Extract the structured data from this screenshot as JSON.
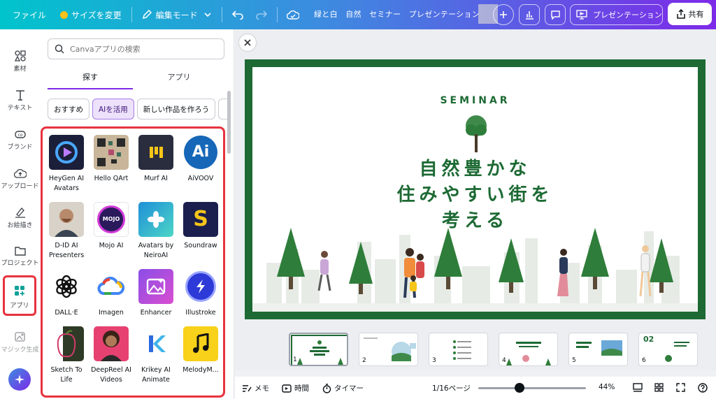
{
  "topbar": {
    "file_menu": "ファイル",
    "resize": "サイズを変更",
    "edit_mode": "編集モード",
    "document_title": "緑と白　自然　セミナー　プレゼンテーション",
    "present": "プレゼンテーション",
    "share": "共有",
    "gradient_colors": [
      "#00c4cc",
      "#3d8be0",
      "#7d2ae8"
    ]
  },
  "rail": {
    "items": [
      {
        "label": "素材",
        "icon": "elements-icon"
      },
      {
        "label": "テキスト",
        "icon": "text-icon"
      },
      {
        "label": "ブランド",
        "icon": "brand-icon"
      },
      {
        "label": "アップロード",
        "icon": "upload-icon"
      },
      {
        "label": "お絵描き",
        "icon": "draw-icon"
      },
      {
        "label": "プロジェクト",
        "icon": "folder-icon"
      },
      {
        "label": "アプリ",
        "icon": "apps-icon"
      },
      {
        "label": "マジック生成",
        "icon": "magic-media-icon"
      }
    ],
    "highlight_color": "#e7323f"
  },
  "panel": {
    "search_placeholder": "Canvaアプリの検索",
    "tabs": [
      "探す",
      "アプリ"
    ],
    "chips": [
      "おすすめ",
      "AIを活用",
      "新しい作品を作ろう"
    ],
    "apps": [
      {
        "name": "HeyGen AI Avatars",
        "color": "#1b1f3a"
      },
      {
        "name": "Hello QArt",
        "color": "#c9b59a"
      },
      {
        "name": "Murf AI",
        "color": "#2a2d3e"
      },
      {
        "name": "AiVOOV",
        "color": "#1667b8"
      },
      {
        "name": "D-ID AI Presenters",
        "color": "#8a7462"
      },
      {
        "name": "Mojo AI",
        "color": "#ffffff"
      },
      {
        "name": "Avatars by NeiroAI",
        "color": "#1f8fd8"
      },
      {
        "name": "Soundraw",
        "color": "#1a1f4d"
      },
      {
        "name": "DALL·E",
        "color": "#ffffff"
      },
      {
        "name": "Imagen",
        "color": "#ffffff"
      },
      {
        "name": "Enhancer",
        "color": "#8a4ee8"
      },
      {
        "name": "Illustroke",
        "color": "#ffffff"
      },
      {
        "name": "Sketch To Life",
        "color": "#d9e8c8"
      },
      {
        "name": "DeepReel AI Videos",
        "color": "#e64170"
      },
      {
        "name": "Krikey AI Animate",
        "color": "#ffffff"
      },
      {
        "name": "MelodyM...",
        "color": "#f7d11a"
      }
    ],
    "accent_color": "#7d2ae8"
  },
  "slide": {
    "eyebrow": "SEMINAR",
    "headline_lines": [
      "自然豊かな",
      "住みやすい街を",
      "考える"
    ],
    "frame_color": "#1d6a34"
  },
  "filmstrip": {
    "pages": [
      "1",
      "2",
      "3",
      "4",
      "5",
      "6"
    ]
  },
  "bottombar": {
    "notes": "メモ",
    "timing": "時間",
    "timer": "タイマー",
    "page_indicator": "1/16ページ",
    "zoom": "44%"
  }
}
